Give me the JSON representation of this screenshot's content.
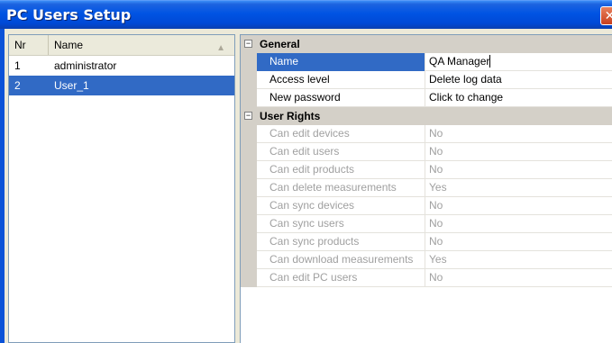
{
  "window": {
    "title": "PC Users Setup",
    "close_glyph": "✕"
  },
  "users_list": {
    "columns": {
      "nr": "Nr",
      "name": "Name"
    },
    "sort_glyph": "▲",
    "rows": [
      {
        "nr": "1",
        "name": "administrator",
        "selected": false
      },
      {
        "nr": "2",
        "name": "User_1",
        "selected": true
      }
    ]
  },
  "properties": {
    "collapse_glyph": "−",
    "general": {
      "title": "General",
      "items": [
        {
          "name": "Name",
          "value": "QA Manager",
          "selected": true,
          "editing": true
        },
        {
          "name": "Access level",
          "value": "Delete log data"
        },
        {
          "name": "New password",
          "value": "Click to change"
        }
      ]
    },
    "user_rights": {
      "title": "User Rights",
      "items": [
        {
          "name": "Can edit devices",
          "value": "No"
        },
        {
          "name": "Can edit users",
          "value": "No"
        },
        {
          "name": "Can edit products",
          "value": "No"
        },
        {
          "name": "Can delete measurements",
          "value": "Yes"
        },
        {
          "name": "Can sync devices",
          "value": "No"
        },
        {
          "name": "Can sync users",
          "value": "No"
        },
        {
          "name": "Can sync products",
          "value": "No"
        },
        {
          "name": "Can download measurements",
          "value": "Yes"
        },
        {
          "name": "Can edit PC users",
          "value": "No"
        }
      ]
    }
  },
  "colors": {
    "titlebar": "#0054e3",
    "selection": "#316ac5",
    "readonly_text": "#a0a0a0"
  }
}
